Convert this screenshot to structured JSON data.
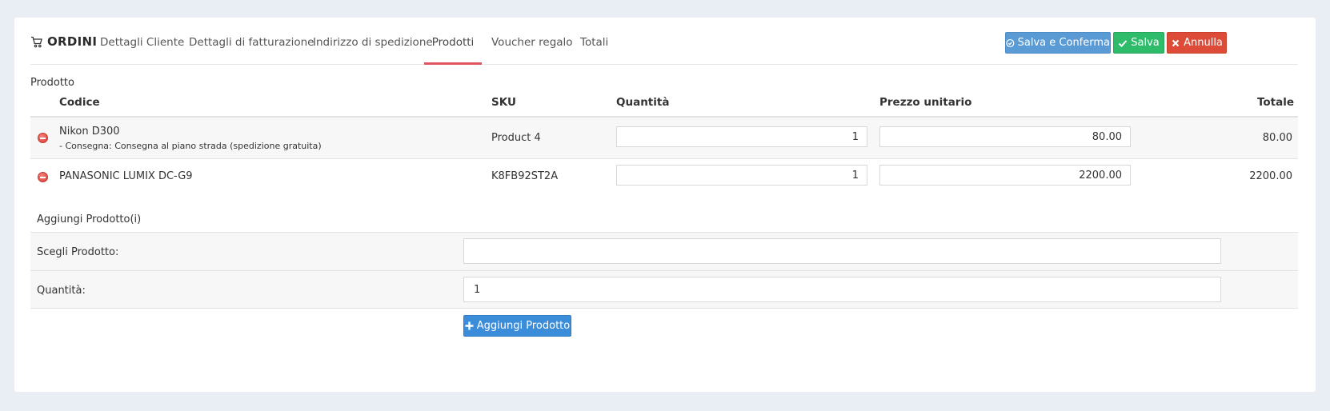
{
  "header": {
    "brand": "ORDINI",
    "brand_icon": "cart-icon",
    "tabs": [
      {
        "label": "Dettagli Cliente"
      },
      {
        "label": "Dettagli di fatturazione"
      },
      {
        "label": "Indirizzo di spedizione"
      },
      {
        "label": "Prodotti",
        "active": true
      },
      {
        "label": "Voucher regalo"
      },
      {
        "label": "Totali"
      }
    ],
    "buttons": {
      "save_confirm": "Salva e Conferma",
      "save": "Salva",
      "cancel": "Annulla"
    }
  },
  "products": {
    "section_label": "Prodotto",
    "columns": {
      "code": "Codice",
      "sku": "SKU",
      "qty": "Quantità",
      "unit_price": "Prezzo unitario",
      "total": "Totale"
    },
    "rows": [
      {
        "name": "Nikon D300",
        "option": "- Consegna: Consegna al piano strada (spedizione gratuita)",
        "sku": "Product 4",
        "qty": "1",
        "unit_price": "80.00",
        "total": "80.00"
      },
      {
        "name": "PANASONIC LUMIX DC-G9",
        "option": "",
        "sku": "K8FB92ST2A",
        "qty": "1",
        "unit_price": "2200.00",
        "total": "2200.00"
      }
    ]
  },
  "add_product": {
    "title": "Aggiungi Prodotto(i)",
    "choose_label": "Scegli Prodotto:",
    "choose_value": "",
    "qty_label": "Quantità:",
    "qty_value": "1",
    "button": "Aggiungi Prodotto"
  },
  "colors": {
    "accent_tab": "#e0555f",
    "blue": "#5b9bd5",
    "green": "#2ebc6b",
    "red": "#dd4b39",
    "add_blue": "#3c8dd9"
  }
}
